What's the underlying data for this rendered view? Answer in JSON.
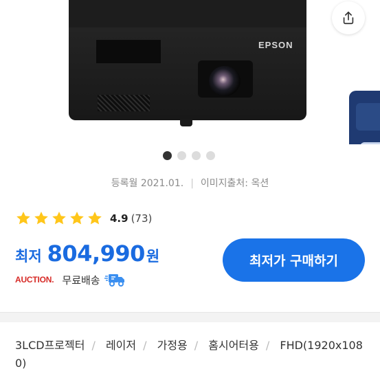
{
  "gallery": {
    "product_brand": "EPSON",
    "page_count": 4,
    "active_page": 1,
    "share_icon": "share-icon"
  },
  "product": {
    "registered_label": "등록월 2021.01.",
    "image_source": "이미지출처: 옥션",
    "rating": {
      "stars": 5,
      "score": "4.9",
      "count": "(73)",
      "star_color": "#FFC61A"
    },
    "price": {
      "label": "최저",
      "value": "804,990",
      "unit": "원",
      "color": "#1A6BE0"
    },
    "seller": {
      "name": "AUCTION.",
      "shipping": "무료배송",
      "shipping_icon": "delivery-truck-icon"
    },
    "buy_button_label": "최저가 구매하기"
  },
  "tags": [
    "3LCD프로젝터",
    "레이저",
    "가정용",
    "홈시어터용",
    "FHD(1920x1080)"
  ]
}
